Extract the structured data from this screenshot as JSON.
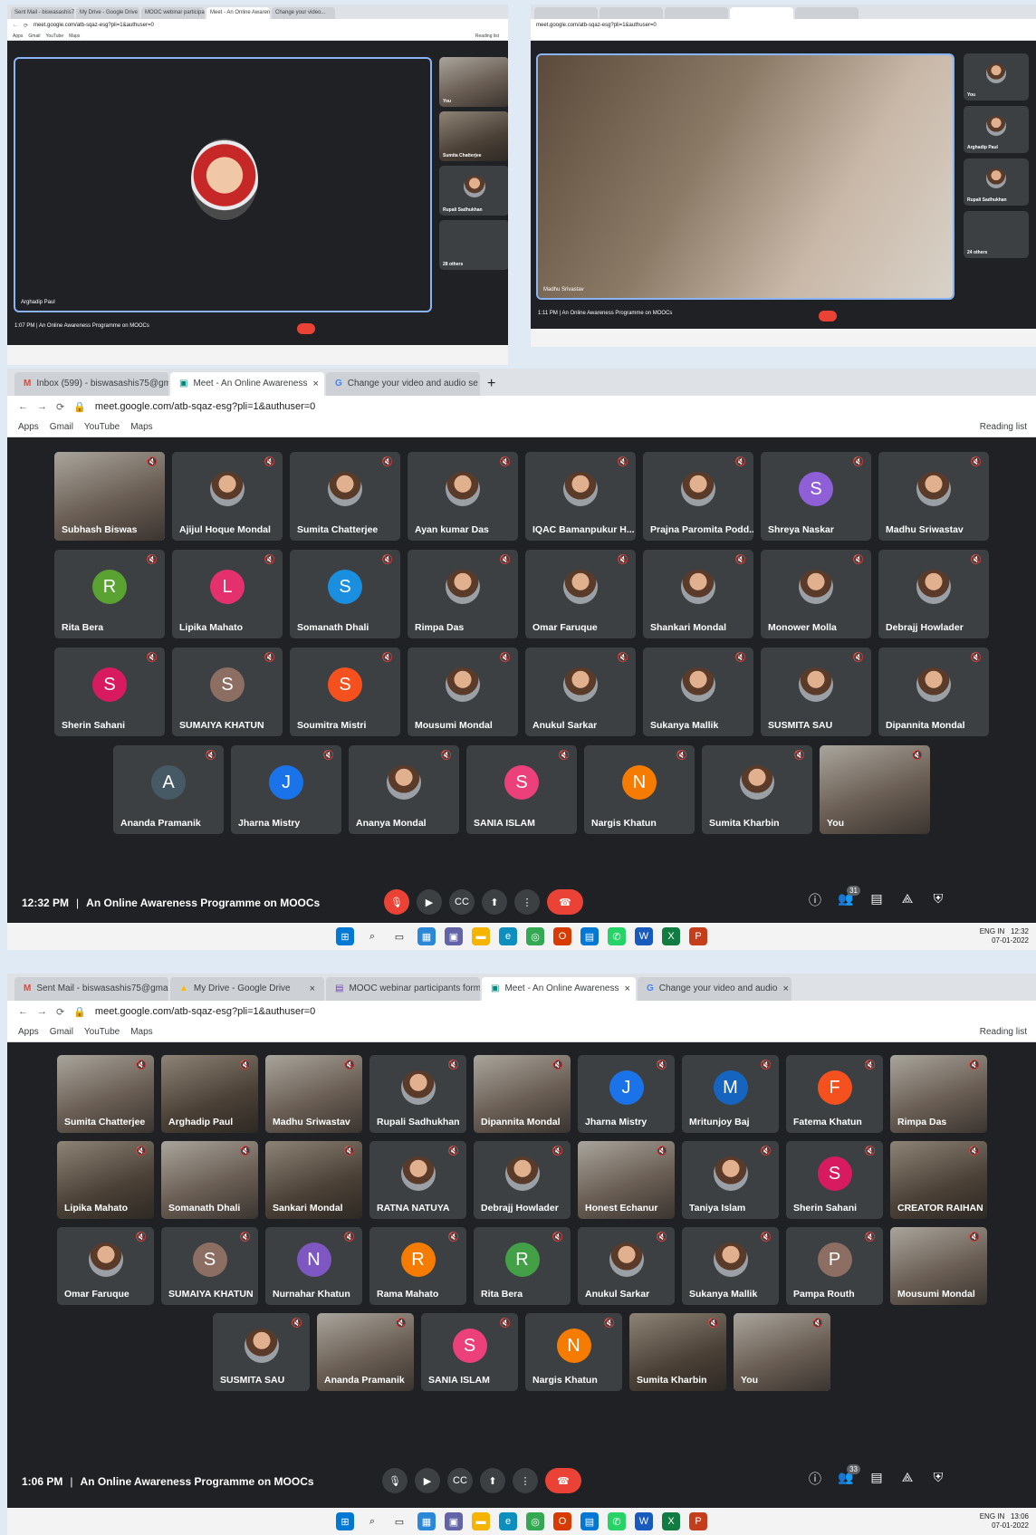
{
  "top_left": {
    "tabs": [
      "Sent Mail - biswasashis75@gma",
      "My Drive - Google Drive",
      "MOOC webinar participants form",
      "Meet - An Online Awarene",
      "Change your video..."
    ],
    "url": "meet.google.com/atb-sqaz-esg?pli=1&authuser=0",
    "bookmarks": [
      "Apps",
      "Gmail",
      "YouTube",
      "Maps"
    ],
    "reading_list": "Reading list",
    "presenter": "Arghadip Paul",
    "side": [
      "You",
      "Sumita Chatterjee",
      "Rupali Sadhukhan",
      "28 others"
    ],
    "time": "1:07 PM",
    "meeting": "An Online Awareness Programme on MOOCs"
  },
  "top_right": {
    "url": "meet.google.com/atb-sqaz-esg?pli=1&authuser=0",
    "presenter": "Madhu Srivastav",
    "side": [
      "You",
      "Arghadip Paul",
      "Rupali Sadhukhan",
      "24 others"
    ],
    "time": "1:11 PM",
    "meeting": "An Online Awareness Programme on MOOCs"
  },
  "middle": {
    "tabs": [
      "Inbox (599) - biswasashis75@gm",
      "Meet - An Online Awareness",
      "Change your video and audio se"
    ],
    "url": "meet.google.com/atb-sqaz-esg?pli=1&authuser=0",
    "bookmarks": [
      "Apps",
      "Gmail",
      "YouTube",
      "Maps"
    ],
    "reading_list": "Reading list",
    "participants": [
      {
        "name": "Subhash Biswas",
        "kind": "video"
      },
      {
        "name": "Ajijul Hoque Mondal",
        "kind": "photo"
      },
      {
        "name": "Sumita Chatterjee",
        "kind": "photo"
      },
      {
        "name": "Ayan kumar Das",
        "kind": "photo"
      },
      {
        "name": "IQAC Bamanpukur H...",
        "kind": "photo"
      },
      {
        "name": "Prajna Paromita Podd...",
        "kind": "photo"
      },
      {
        "name": "Shreya Naskar",
        "kind": "letter",
        "letter": "S",
        "color": "#8e5fd6"
      },
      {
        "name": "Madhu Sriwastav",
        "kind": "photo"
      },
      {
        "name": "Rita Bera",
        "kind": "letter",
        "letter": "R",
        "color": "#5aa332"
      },
      {
        "name": "Lipika Mahato",
        "kind": "letter",
        "letter": "L",
        "color": "#e5306e"
      },
      {
        "name": "Somanath Dhali",
        "kind": "letter",
        "letter": "S",
        "color": "#1a8fe0"
      },
      {
        "name": "Rimpa Das",
        "kind": "photo"
      },
      {
        "name": "Omar Faruque",
        "kind": "photo"
      },
      {
        "name": "Shankari Mondal",
        "kind": "photo"
      },
      {
        "name": "Monower Molla",
        "kind": "photo"
      },
      {
        "name": "Debrajj Howlader",
        "kind": "photo"
      },
      {
        "name": "Sherin Sahani",
        "kind": "letter",
        "letter": "S",
        "color": "#d81b60"
      },
      {
        "name": "SUMAIYA KHATUN",
        "kind": "letter",
        "letter": "S",
        "color": "#8d6e63"
      },
      {
        "name": "Soumitra Mistri",
        "kind": "letter",
        "letter": "S",
        "color": "#f4511e"
      },
      {
        "name": "Mousumi Mondal",
        "kind": "photo"
      },
      {
        "name": "Anukul Sarkar",
        "kind": "photo"
      },
      {
        "name": "Sukanya Mallik",
        "kind": "photo"
      },
      {
        "name": "SUSMITA SAU",
        "kind": "photo"
      },
      {
        "name": "Dipannita Mondal",
        "kind": "photo"
      },
      {
        "name": "Ananda Pramanik",
        "kind": "letter",
        "letter": "A",
        "color": "#455a64"
      },
      {
        "name": "Jharna Mistry",
        "kind": "letter",
        "letter": "J",
        "color": "#1a73e8"
      },
      {
        "name": "Ananya Mondal",
        "kind": "photo"
      },
      {
        "name": "SANIA ISLAM",
        "kind": "letter",
        "letter": "S",
        "color": "#ec407a"
      },
      {
        "name": "Nargis Khatun",
        "kind": "letter",
        "letter": "N",
        "color": "#f57c00"
      },
      {
        "name": "Sumita Kharbin",
        "kind": "photo"
      },
      {
        "name": "You",
        "kind": "video"
      }
    ],
    "time": "12:32 PM",
    "meeting": "An Online Awareness Programme on MOOCs",
    "people_count": "31",
    "lang": "ENG",
    "region": "IN",
    "clock": "12:32",
    "date": "07-01-2022"
  },
  "bottom": {
    "tabs": [
      "Sent Mail - biswasashis75@gma",
      "My Drive - Google Drive",
      "MOOC webinar participants form",
      "Meet - An Online Awareness",
      "Change your video and audio"
    ],
    "url": "meet.google.com/atb-sqaz-esg?pli=1&authuser=0",
    "bookmarks": [
      "Apps",
      "Gmail",
      "YouTube",
      "Maps"
    ],
    "reading_list": "Reading list",
    "participants": [
      {
        "name": "Sumita Chatterjee",
        "kind": "video"
      },
      {
        "name": "Arghadip Paul",
        "kind": "video"
      },
      {
        "name": "Madhu Sriwastav",
        "kind": "video"
      },
      {
        "name": "Rupali Sadhukhan",
        "kind": "photo"
      },
      {
        "name": "Dipannita Mondal",
        "kind": "video"
      },
      {
        "name": "Jharna Mistry",
        "kind": "letter",
        "letter": "J",
        "color": "#1a73e8"
      },
      {
        "name": "Mritunjoy Baj",
        "kind": "letter",
        "letter": "M",
        "color": "#1565c0"
      },
      {
        "name": "Fatema Khatun",
        "kind": "letter",
        "letter": "F",
        "color": "#f4511e"
      },
      {
        "name": "Rimpa Das",
        "kind": "video"
      },
      {
        "name": "Lipika Mahato",
        "kind": "video"
      },
      {
        "name": "Somanath Dhali",
        "kind": "video"
      },
      {
        "name": "Sankari Mondal",
        "kind": "video"
      },
      {
        "name": "RATNA NATUYA",
        "kind": "photo"
      },
      {
        "name": "Debrajj Howlader",
        "kind": "photo"
      },
      {
        "name": "Honest Echanur",
        "kind": "video"
      },
      {
        "name": "Taniya Islam",
        "kind": "photo"
      },
      {
        "name": "Sherin Sahani",
        "kind": "letter",
        "letter": "S",
        "color": "#d81b60"
      },
      {
        "name": "CREATOR RAIHAN",
        "kind": "video"
      },
      {
        "name": "Omar Faruque",
        "kind": "photo"
      },
      {
        "name": "SUMAIYA KHATUN",
        "kind": "letter",
        "letter": "S",
        "color": "#8d6e63"
      },
      {
        "name": "Nurnahar Khatun",
        "kind": "letter",
        "letter": "N",
        "color": "#7e57c2"
      },
      {
        "name": "Rama Mahato",
        "kind": "letter",
        "letter": "R",
        "color": "#f57c00"
      },
      {
        "name": "Rita Bera",
        "kind": "letter",
        "letter": "R",
        "color": "#43a047"
      },
      {
        "name": "Anukul Sarkar",
        "kind": "photo"
      },
      {
        "name": "Sukanya Mallik",
        "kind": "photo"
      },
      {
        "name": "Pampa Routh",
        "kind": "letter",
        "letter": "P",
        "color": "#8d6e63"
      },
      {
        "name": "Mousumi Mondal",
        "kind": "video"
      },
      {
        "name": "SUSMITA SAU",
        "kind": "photo"
      },
      {
        "name": "Ananda Pramanik",
        "kind": "video"
      },
      {
        "name": "SANIA ISLAM",
        "kind": "letter",
        "letter": "S",
        "color": "#ec407a"
      },
      {
        "name": "Nargis Khatun",
        "kind": "letter",
        "letter": "N",
        "color": "#f57c00"
      },
      {
        "name": "Sumita Kharbin",
        "kind": "video"
      },
      {
        "name": "You",
        "kind": "video"
      }
    ],
    "time": "1:06 PM",
    "meeting": "An Online Awareness Programme on MOOCs",
    "people_count": "33",
    "lang": "ENG",
    "region": "IN",
    "clock": "13:06",
    "date": "07-01-2022"
  }
}
